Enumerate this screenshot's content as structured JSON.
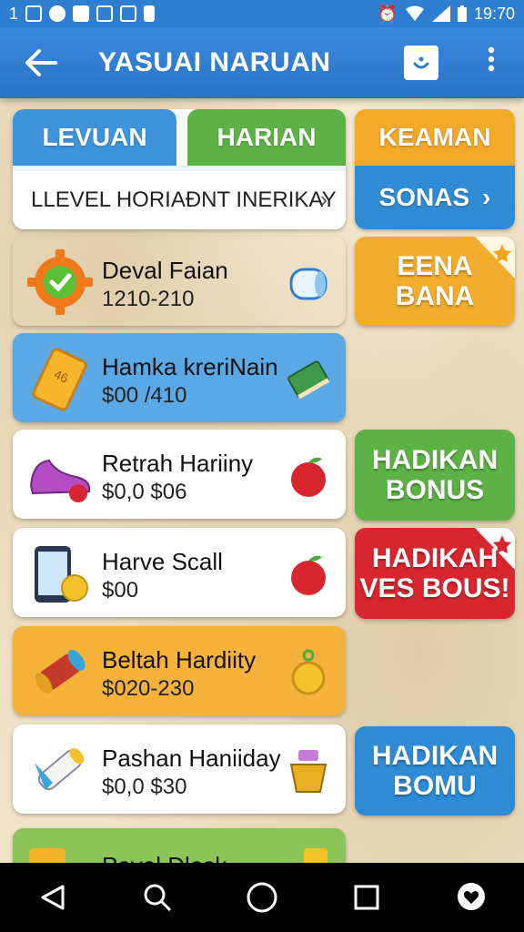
{
  "status_bar": {
    "left_text": "1",
    "time": "19:70"
  },
  "app_bar": {
    "title": "YASUAI NARUAN"
  },
  "tabs": [
    {
      "label": "LEVUAN"
    },
    {
      "label": "HARIAN"
    }
  ],
  "subrow": {
    "label": "LLEVEL HORIAÐNT INERIKAY"
  },
  "right_panel": {
    "top_label": "KEAMAN",
    "bottom_label": "SONAS"
  },
  "items": [
    {
      "name": "Deval Faian",
      "price": "1210-210",
      "icon": "gear-check-icon",
      "right_icon": "jar-icon",
      "bg": "#ffffff"
    },
    {
      "name": "Hamka kreriNain",
      "price": "$00 /410",
      "icon": "gold-bar-icon",
      "right_icon": "green-book-icon",
      "bg": "#5aa8e6"
    },
    {
      "name": "Retrah Hariiny",
      "price": "$0,0 $06",
      "icon": "purple-shoe-icon",
      "right_icon": "apple-icon",
      "bg": "#ffffff"
    },
    {
      "name": "Harve Scall",
      "price": "$00",
      "icon": "phone-coin-icon",
      "right_icon": "apple-icon",
      "bg": "#ffffff"
    },
    {
      "name": "Beltah Hardiity",
      "price": "$020-230",
      "icon": "scroll-icon",
      "right_icon": "coin-icon",
      "bg": "#f6b23a"
    },
    {
      "name": "Pashan Haniiday",
      "price": "$0,0 $30",
      "icon": "rolled-paper-icon",
      "right_icon": "honey-pot-icon",
      "bg": "#ffffff"
    },
    {
      "name": "Povel Dlesk",
      "price": "",
      "icon": "folder-icon",
      "right_icon": "gold-box-icon",
      "bg": "#8cc45a"
    }
  ],
  "banners": [
    {
      "line1": "EENA",
      "line2": "BANA",
      "color": "#f3ad2c"
    },
    {
      "line1": "HADIKAN",
      "line2": "BONUS",
      "color": "#5db246"
    },
    {
      "line1": "HADIKAH",
      "line2": "VES BOUS!",
      "color": "#d8262f"
    },
    {
      "line1": "HADIKAN",
      "line2": "BOMU",
      "color": "#2f8bd3"
    }
  ],
  "colors": {
    "primary": "#2f7fd0",
    "green": "#5db246",
    "orange": "#f3ad2c",
    "red": "#d8262f"
  }
}
